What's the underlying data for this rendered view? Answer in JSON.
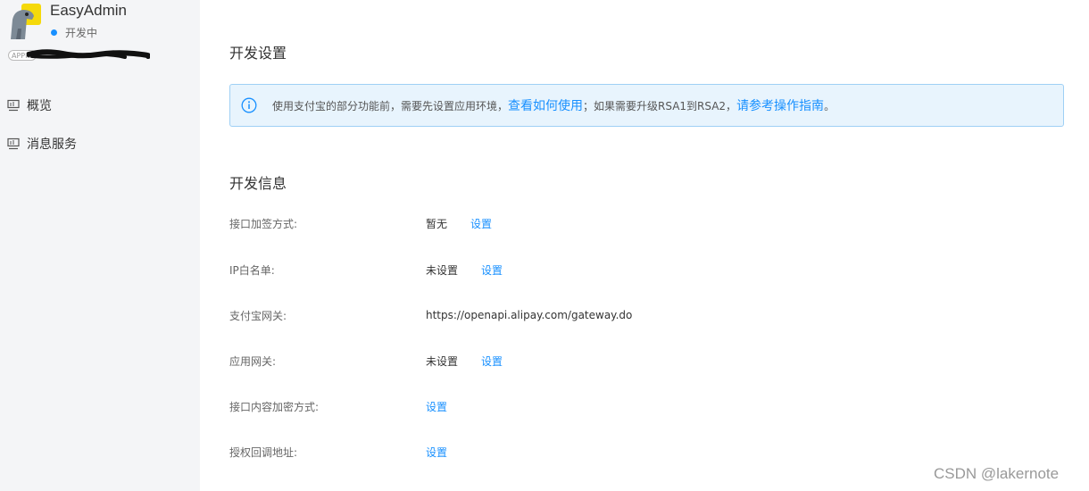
{
  "sidebar": {
    "app_name": "EasyAdmin",
    "status": "开发中",
    "appid_badge": "APPID",
    "nav": [
      {
        "label": "概览",
        "icon": "monitor-icon"
      },
      {
        "label": "消息服务",
        "icon": "monitor-icon"
      }
    ]
  },
  "main": {
    "dev_settings_title": "开发设置",
    "notice": {
      "text1": "使用支付宝的部分功能前，需要先设置应用环境，",
      "link1": "查看如何使用",
      "text2": "；如果需要升级RSA1到RSA2，",
      "link2": "请参考操作指南",
      "text3": "。"
    },
    "dev_info_title": "开发信息",
    "rows": [
      {
        "label": "接口加签方式:",
        "value": "暂无",
        "action": "设置"
      },
      {
        "label": "IP白名单:",
        "value": "未设置",
        "action": "设置"
      },
      {
        "label": "支付宝网关:",
        "value": "https://openapi.alipay.com/gateway.do"
      },
      {
        "label": "应用网关:",
        "value": "未设置",
        "action": "设置"
      },
      {
        "label": "接口内容加密方式:",
        "action": "设置"
      },
      {
        "label": "授权回调地址:",
        "action": "设置"
      }
    ]
  },
  "watermark": "CSDN @lakernote",
  "colors": {
    "accent": "#1890ff",
    "notice_bg": "#e8f4fd",
    "sidebar_bg": "#f4f5f7"
  }
}
